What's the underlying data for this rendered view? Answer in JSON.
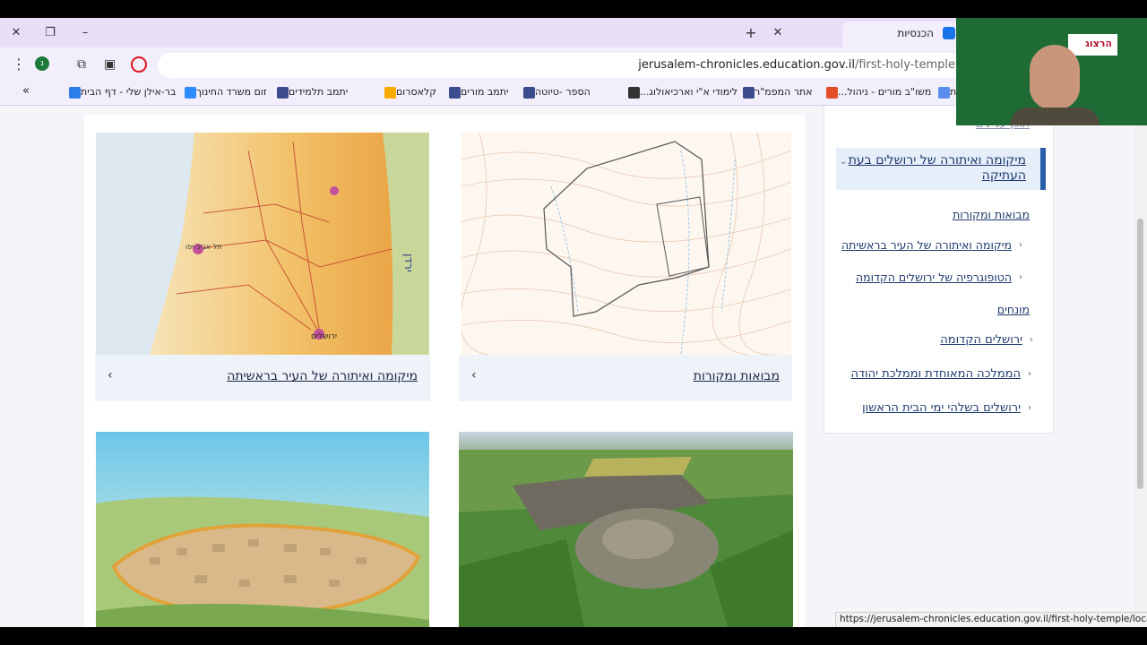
{
  "browser": {
    "active_tab": {
      "title": "הכנסיות"
    },
    "address_bar": {
      "url_host": "jerusalem-chronicles.education.gov.il",
      "url_path": "/first-holy-temple"
    },
    "bookmarks": [
      {
        "label": "בר-אילן שלי - דף הבית",
        "color": "#2b7de9"
      },
      {
        "label": "זום משרד החינוך",
        "color": "#2d8cff"
      },
      {
        "label": "יתמב תלמידים",
        "color": "#3c4c8c"
      },
      {
        "label": "קלאסרום",
        "color": "#f9ab00"
      },
      {
        "label": "יתמב מורים",
        "color": "#3c4c8c"
      },
      {
        "label": "הספר -טיוטה",
        "color": "#3c4c8c"
      },
      {
        "label": "לימודי א\"י וארכיאולוג...",
        "color": "#333333"
      },
      {
        "label": "אתר המפמ\"ר",
        "color": "#3c4c8c"
      },
      {
        "label": "משו\"ב מורים - ניהול...",
        "color": "#e44d26"
      },
      {
        "label": "פחות",
        "color": "#5b8def"
      }
    ],
    "more_bookmarks_glyph": "»",
    "status_url": "https://jerusalem-chronicles.education.gov.il/first-holy-temple/location/intro/"
  },
  "cards": [
    {
      "caption": "מבואות ומקורות"
    },
    {
      "caption": "מיקומה ואיתורה של העיר בראשיתה"
    }
  ],
  "map_labels": {
    "yarden": "ירדן",
    "tel_aviv": "תל אביב-יפו",
    "jerusalem": "ירושלים"
  },
  "sidebar": {
    "top_cut": "תוכן עניינים",
    "active": "מיקומה ואיתורה של ירושלים בעת העתיקה",
    "items": [
      {
        "label": "מבואות ומקורות",
        "chevron": false
      },
      {
        "label": "מיקומה ואיתורה של העיר בראשיתה",
        "chevron": true
      },
      {
        "label": "הטופוגרפיה של ירושלים הקדומה",
        "chevron": true
      },
      {
        "label": "מונחים",
        "chevron": false
      },
      {
        "label": "ירושלים הקדומה",
        "chevron": true
      },
      {
        "label": "הממלכה המאוחדת וממלכת יהודה",
        "chevron": true
      },
      {
        "label": "ירושלים בשלהי ימי הבית הראשון",
        "chevron": true
      }
    ]
  },
  "webcam": {
    "logo": "הרצוג"
  },
  "colors": {
    "accent": "#2b5ea8",
    "link": "#1f3a6e",
    "caption_bg": "#eef3fa"
  }
}
